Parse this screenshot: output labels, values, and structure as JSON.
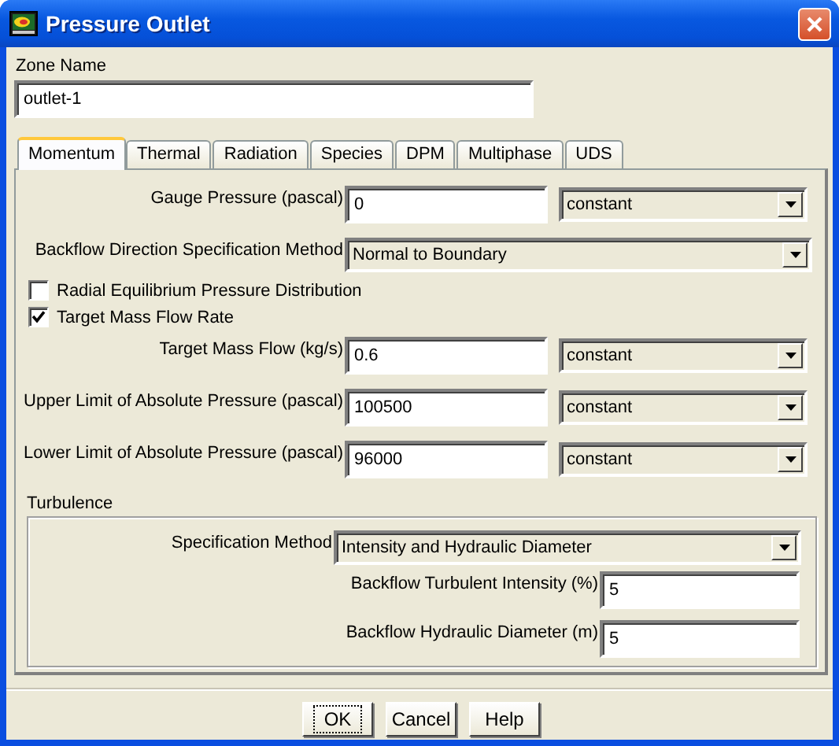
{
  "window": {
    "title": "Pressure Outlet"
  },
  "zone_name": {
    "label": "Zone Name",
    "value": "outlet-1"
  },
  "tabs": [
    {
      "label": "Momentum",
      "selected": true
    },
    {
      "label": "Thermal",
      "selected": false
    },
    {
      "label": "Radiation",
      "selected": false
    },
    {
      "label": "Species",
      "selected": false
    },
    {
      "label": "DPM",
      "selected": false
    },
    {
      "label": "Multiphase",
      "selected": false
    },
    {
      "label": "UDS",
      "selected": false
    }
  ],
  "momentum": [
    {
      "kind": "profile",
      "label": "Gauge Pressure (pascal)",
      "value": "0",
      "profile": "constant"
    },
    {
      "kind": "dropdown",
      "label": "Backflow Direction Specification Method",
      "value": "Normal to Boundary"
    },
    {
      "kind": "checkbox",
      "label": "Radial Equilibrium Pressure Distribution",
      "checked": false
    },
    {
      "kind": "checkbox",
      "label": "Target Mass Flow Rate",
      "checked": true
    },
    {
      "kind": "profile",
      "label": "Target Mass Flow (kg/s)",
      "value": "0.6",
      "profile": "constant"
    },
    {
      "kind": "profile",
      "label": "Upper Limit of Absolute Pressure (pascal)",
      "value": "100500",
      "profile": "constant"
    },
    {
      "kind": "profile",
      "label": "Lower Limit of Absolute Pressure (pascal)",
      "value": "96000",
      "profile": "constant"
    }
  ],
  "turbulence": {
    "title": "Turbulence",
    "fields": [
      {
        "kind": "dropdown",
        "label": "Specification Method",
        "value": "Intensity and Hydraulic Diameter"
      },
      {
        "kind": "field",
        "label": "Backflow Turbulent Intensity (%)",
        "value": "5"
      },
      {
        "kind": "field",
        "label": "Backflow Hydraulic Diameter (m)",
        "value": "5"
      }
    ]
  },
  "buttons": [
    {
      "label": "OK",
      "focused": true
    },
    {
      "label": "Cancel",
      "focused": false
    },
    {
      "label": "Help",
      "focused": false
    }
  ]
}
